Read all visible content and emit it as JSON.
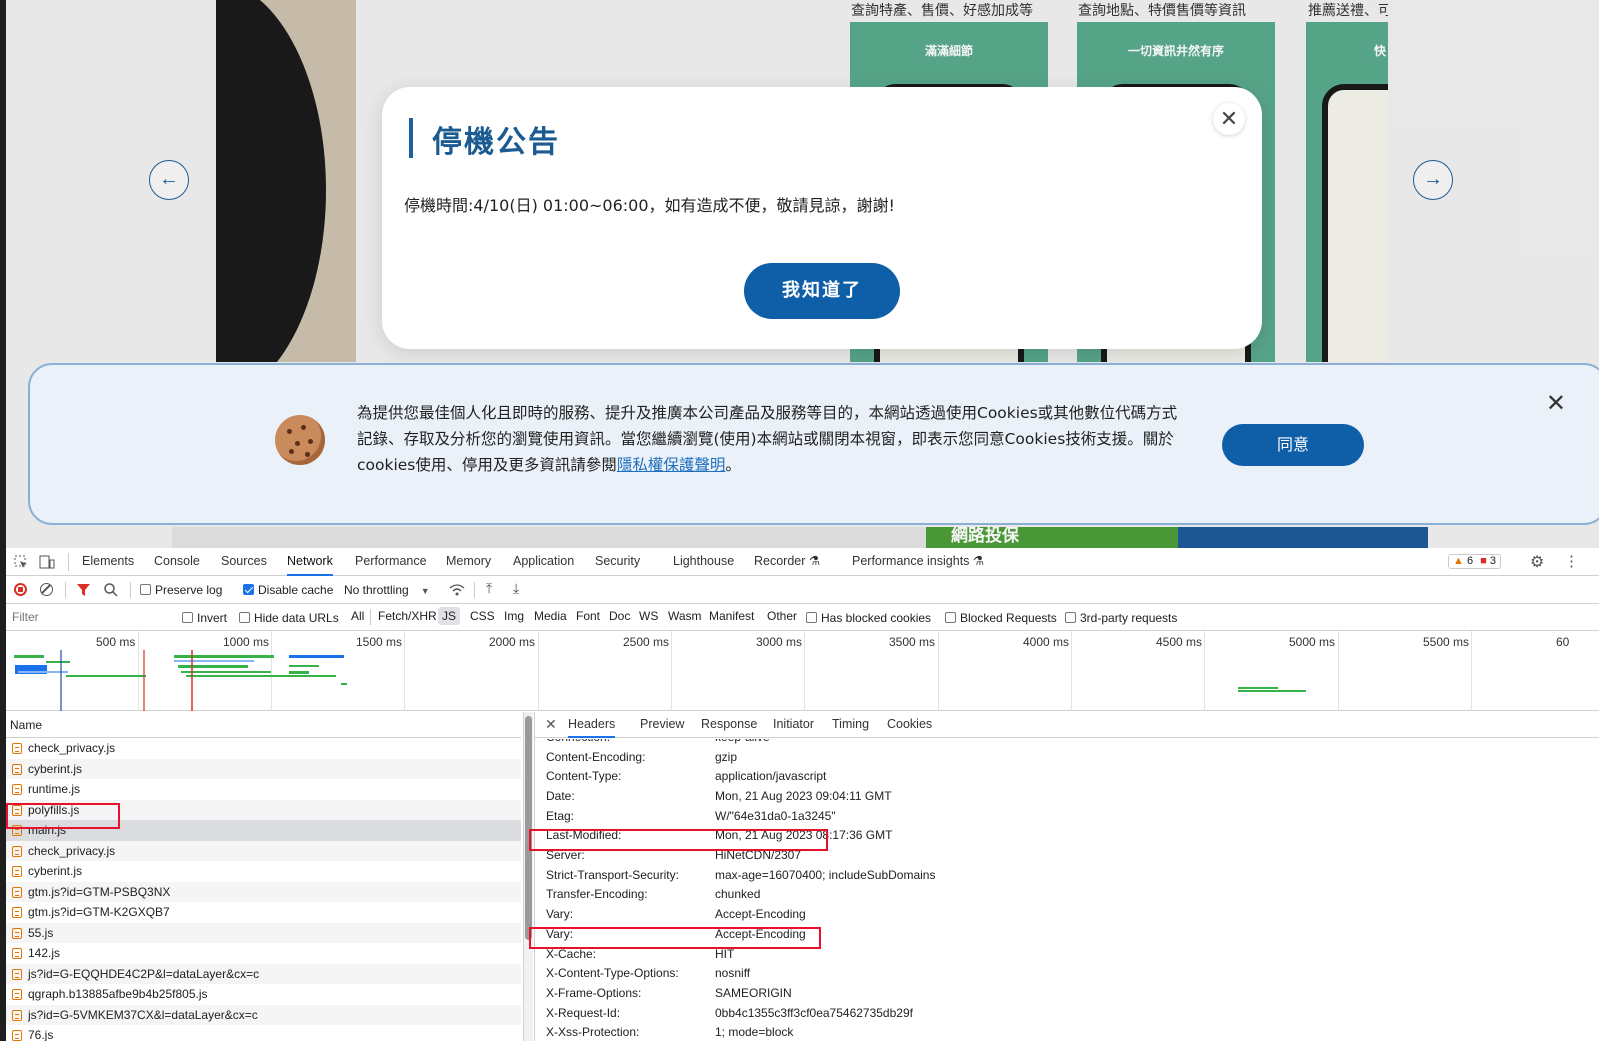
{
  "website": {
    "captions": [
      "查詢特產、售價、好感加成等",
      "查詢地點、特價售價等資訊",
      "推薦送禮、可"
    ],
    "screenshot_titles": [
      "滿滿細節",
      "一切資訊井然有序",
      "快"
    ],
    "arrow_prev": "←",
    "arrow_next": "→",
    "banner_strip_text": "網路投保",
    "modal": {
      "title": "停機公告",
      "message": "停機時間:4/10(日) 01:00~06:00，如有造成不便，敬請見諒，謝謝!",
      "button": "我知道了",
      "close": "✕"
    },
    "cookie_banner": {
      "text": "為提供您最佳個人化且即時的服務、提升及推廣本公司產品及服務等目的，本網站透過使用Cookies或其他數位代碼方式記錄、存取及分析您的瀏覽使用資訊。當您繼續瀏覽(使用)本網站或關閉本視窗，即表示您同意Cookies技術支援。關於cookies使用、停用及更多資訊請參閱",
      "link": "隱私權保護聲明",
      "suffix": "。",
      "agree": "同意",
      "close": "✕"
    }
  },
  "devtools": {
    "tabs": [
      "Elements",
      "Console",
      "Sources",
      "Network",
      "Performance",
      "Memory",
      "Application",
      "Security",
      "Lighthouse",
      "Recorder ⚗",
      "Performance insights ⚗"
    ],
    "active_tab": "Network",
    "warnings": "6",
    "errors": "3",
    "toolbar": {
      "preserve_log": "Preserve log",
      "disable_cache": "Disable cache",
      "throttling": "No throttling"
    },
    "filterbar": {
      "filter_placeholder": "Filter",
      "invert": "Invert",
      "hide_data_urls": "Hide data URLs",
      "types": [
        "All",
        "Fetch/XHR",
        "JS",
        "CSS",
        "Img",
        "Media",
        "Font",
        "Doc",
        "WS",
        "Wasm",
        "Manifest",
        "Other"
      ],
      "active_type": "JS",
      "has_blocked_cookies": "Has blocked cookies",
      "blocked_requests": "Blocked Requests",
      "third_party": "3rd-party requests"
    },
    "timeline_ticks": [
      "500 ms",
      "1000 ms",
      "1500 ms",
      "2000 ms",
      "2500 ms",
      "3000 ms",
      "3500 ms",
      "4000 ms",
      "4500 ms",
      "5000 ms",
      "5500 ms",
      "60"
    ],
    "name_header": "Name",
    "requests": [
      "check_privacy.js",
      "cyberint.js",
      "runtime.js",
      "polyfills.js",
      "main.js",
      "check_privacy.js",
      "cyberint.js",
      "gtm.js?id=GTM-PSBQ3NX",
      "gtm.js?id=GTM-K2GXQB7",
      "55.js",
      "142.js",
      "js?id=G-EQQHDE4C2P&l=dataLayer&cx=c",
      "qgraph.b13885afbe9b4b25f805.js",
      "js?id=G-5VMKEM37CX&l=dataLayer&cx=c",
      "76.js"
    ],
    "selected_request": "main.js",
    "detail_tabs": [
      "Headers",
      "Preview",
      "Response",
      "Initiator",
      "Timing",
      "Cookies"
    ],
    "active_detail_tab": "Headers",
    "headers": [
      {
        "key": "Connection:",
        "value": "keep-alive"
      },
      {
        "key": "Content-Encoding:",
        "value": "gzip"
      },
      {
        "key": "Content-Type:",
        "value": "application/javascript"
      },
      {
        "key": "Date:",
        "value": "Mon, 21 Aug 2023 09:04:11 GMT"
      },
      {
        "key": "Etag:",
        "value": "W/\"64e31da0-1a3245\""
      },
      {
        "key": "Last-Modified:",
        "value": "Mon, 21 Aug 2023 08:17:36 GMT"
      },
      {
        "key": "Server:",
        "value": "HiNetCDN/2307"
      },
      {
        "key": "Strict-Transport-Security:",
        "value": "max-age=16070400; includeSubDomains"
      },
      {
        "key": "Transfer-Encoding:",
        "value": "chunked"
      },
      {
        "key": "Vary:",
        "value": "Accept-Encoding"
      },
      {
        "key": "Vary:",
        "value": "Accept-Encoding"
      },
      {
        "key": "X-Cache:",
        "value": "HIT"
      },
      {
        "key": "X-Content-Type-Options:",
        "value": "nosniff"
      },
      {
        "key": "X-Frame-Options:",
        "value": "SAMEORIGIN"
      },
      {
        "key": "X-Request-Id:",
        "value": "0bb4c1355c3ff3cf0ea75462735db29f"
      },
      {
        "key": "X-Xss-Protection:",
        "value": "1; mode=block"
      }
    ]
  },
  "colors": {
    "brand_blue": "#0f5ea8",
    "highlight_red": "#e8102b",
    "devtools_accent": "#1a73e8"
  }
}
